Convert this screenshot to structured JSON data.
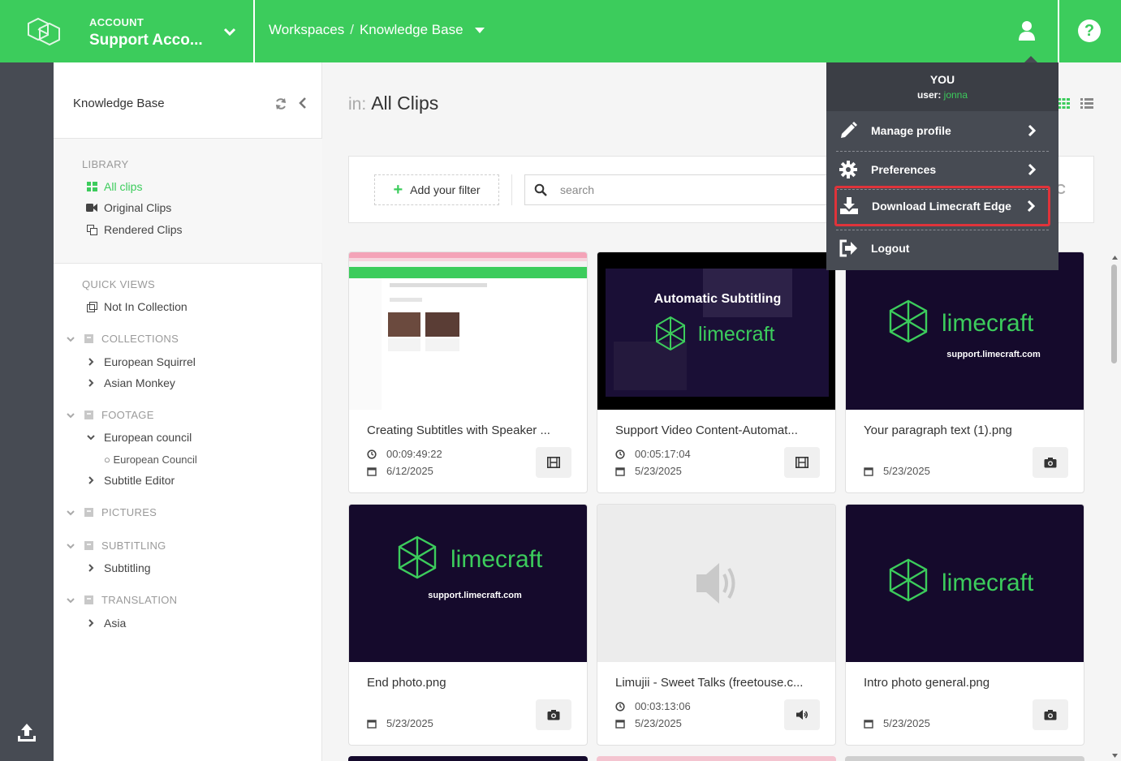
{
  "colors": {
    "brand": "#3ccc5c",
    "rail": "#474b53",
    "highlight": "#e0333a"
  },
  "account": {
    "label": "ACCOUNT",
    "name": "Support Acco..."
  },
  "breadcrumb": {
    "items": [
      "Workspaces",
      "Knowledge Base"
    ],
    "separator": "/"
  },
  "sidebar": {
    "title": "Knowledge Base",
    "library": {
      "heading": "LIBRARY",
      "items": [
        "All clips",
        "Original Clips",
        "Rendered Clips"
      ]
    },
    "quick_views": {
      "heading": "QUICK VIEWS",
      "items": [
        "Not In Collection"
      ]
    },
    "groups": {
      "collections": {
        "label": "COLLECTIONS",
        "items": [
          "European Squirrel",
          "Asian Monkey"
        ]
      },
      "footage": {
        "label": "FOOTAGE",
        "items": [
          "European council",
          "European Council",
          "Subtitle Editor"
        ]
      },
      "pictures": {
        "label": "PICTURES"
      },
      "subtitling": {
        "label": "SUBTITLING",
        "items": [
          "Subtitling"
        ]
      },
      "translation": {
        "label": "TRANSLATION",
        "items": [
          "Asia"
        ]
      }
    }
  },
  "main": {
    "in_label": "in:",
    "title": "All Clips",
    "add_filter": "Add your filter",
    "search_placeholder": "search"
  },
  "cards": [
    {
      "title": "Creating Subtitles with Speaker ...",
      "duration": "00:09:49:22",
      "date": "6/12/2025",
      "type_icon": "film-icon"
    },
    {
      "title": "Support Video Content-Automat...",
      "duration": "00:05:17:04",
      "date": "5/23/2025",
      "type_icon": "film-icon",
      "thumb_heading": "Automatic Subtitling",
      "thumb_logo": "limecraft"
    },
    {
      "title": "Your paragraph text (1).png",
      "date": "5/23/2025",
      "type_icon": "camera-icon",
      "thumb_logo": "limecraft",
      "thumb_url": "support.limecraft.com"
    },
    {
      "title": "End photo.png",
      "date": "5/23/2025",
      "type_icon": "camera-icon",
      "thumb_logo": "limecraft",
      "thumb_url": "support.limecraft.com"
    },
    {
      "title": "Limujii - Sweet Talks (freetouse.c...",
      "duration": "00:03:13:06",
      "date": "5/23/2025",
      "type_icon": "speaker-icon"
    },
    {
      "title": "Intro photo general.png",
      "date": "5/23/2025",
      "type_icon": "camera-icon",
      "thumb_logo": "limecraft"
    }
  ],
  "user_menu": {
    "you": "YOU",
    "user_label": "user:",
    "username": "jonna",
    "items": [
      "Manage profile",
      "Preferences",
      "Download Limecraft Edge",
      "Logout"
    ]
  }
}
